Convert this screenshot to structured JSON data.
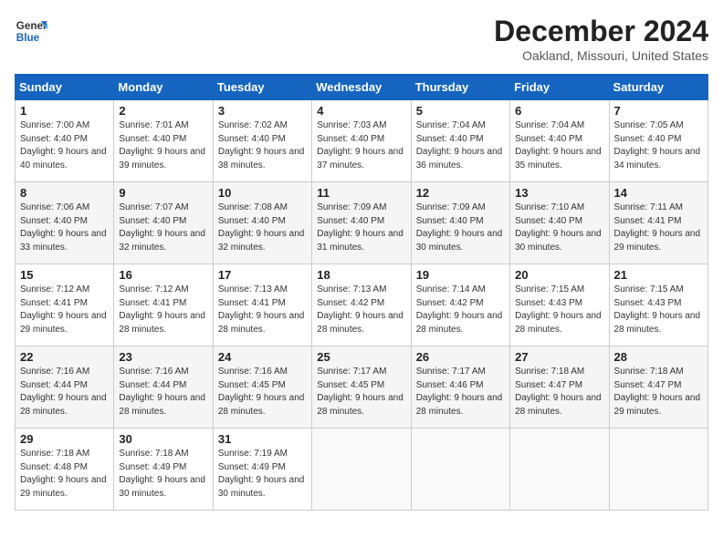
{
  "logo": {
    "line1": "General",
    "line2": "Blue"
  },
  "title": "December 2024",
  "subtitle": "Oakland, Missouri, United States",
  "days_of_week": [
    "Sunday",
    "Monday",
    "Tuesday",
    "Wednesday",
    "Thursday",
    "Friday",
    "Saturday"
  ],
  "weeks": [
    [
      {
        "day": "1",
        "sunrise": "7:00 AM",
        "sunset": "4:40 PM",
        "daylight": "9 hours and 40 minutes."
      },
      {
        "day": "2",
        "sunrise": "7:01 AM",
        "sunset": "4:40 PM",
        "daylight": "9 hours and 39 minutes."
      },
      {
        "day": "3",
        "sunrise": "7:02 AM",
        "sunset": "4:40 PM",
        "daylight": "9 hours and 38 minutes."
      },
      {
        "day": "4",
        "sunrise": "7:03 AM",
        "sunset": "4:40 PM",
        "daylight": "9 hours and 37 minutes."
      },
      {
        "day": "5",
        "sunrise": "7:04 AM",
        "sunset": "4:40 PM",
        "daylight": "9 hours and 36 minutes."
      },
      {
        "day": "6",
        "sunrise": "7:04 AM",
        "sunset": "4:40 PM",
        "daylight": "9 hours and 35 minutes."
      },
      {
        "day": "7",
        "sunrise": "7:05 AM",
        "sunset": "4:40 PM",
        "daylight": "9 hours and 34 minutes."
      }
    ],
    [
      {
        "day": "8",
        "sunrise": "7:06 AM",
        "sunset": "4:40 PM",
        "daylight": "9 hours and 33 minutes."
      },
      {
        "day": "9",
        "sunrise": "7:07 AM",
        "sunset": "4:40 PM",
        "daylight": "9 hours and 32 minutes."
      },
      {
        "day": "10",
        "sunrise": "7:08 AM",
        "sunset": "4:40 PM",
        "daylight": "9 hours and 32 minutes."
      },
      {
        "day": "11",
        "sunrise": "7:09 AM",
        "sunset": "4:40 PM",
        "daylight": "9 hours and 31 minutes."
      },
      {
        "day": "12",
        "sunrise": "7:09 AM",
        "sunset": "4:40 PM",
        "daylight": "9 hours and 30 minutes."
      },
      {
        "day": "13",
        "sunrise": "7:10 AM",
        "sunset": "4:40 PM",
        "daylight": "9 hours and 30 minutes."
      },
      {
        "day": "14",
        "sunrise": "7:11 AM",
        "sunset": "4:41 PM",
        "daylight": "9 hours and 29 minutes."
      }
    ],
    [
      {
        "day": "15",
        "sunrise": "7:12 AM",
        "sunset": "4:41 PM",
        "daylight": "9 hours and 29 minutes."
      },
      {
        "day": "16",
        "sunrise": "7:12 AM",
        "sunset": "4:41 PM",
        "daylight": "9 hours and 28 minutes."
      },
      {
        "day": "17",
        "sunrise": "7:13 AM",
        "sunset": "4:41 PM",
        "daylight": "9 hours and 28 minutes."
      },
      {
        "day": "18",
        "sunrise": "7:13 AM",
        "sunset": "4:42 PM",
        "daylight": "9 hours and 28 minutes."
      },
      {
        "day": "19",
        "sunrise": "7:14 AM",
        "sunset": "4:42 PM",
        "daylight": "9 hours and 28 minutes."
      },
      {
        "day": "20",
        "sunrise": "7:15 AM",
        "sunset": "4:43 PM",
        "daylight": "9 hours and 28 minutes."
      },
      {
        "day": "21",
        "sunrise": "7:15 AM",
        "sunset": "4:43 PM",
        "daylight": "9 hours and 28 minutes."
      }
    ],
    [
      {
        "day": "22",
        "sunrise": "7:16 AM",
        "sunset": "4:44 PM",
        "daylight": "9 hours and 28 minutes."
      },
      {
        "day": "23",
        "sunrise": "7:16 AM",
        "sunset": "4:44 PM",
        "daylight": "9 hours and 28 minutes."
      },
      {
        "day": "24",
        "sunrise": "7:16 AM",
        "sunset": "4:45 PM",
        "daylight": "9 hours and 28 minutes."
      },
      {
        "day": "25",
        "sunrise": "7:17 AM",
        "sunset": "4:45 PM",
        "daylight": "9 hours and 28 minutes."
      },
      {
        "day": "26",
        "sunrise": "7:17 AM",
        "sunset": "4:46 PM",
        "daylight": "9 hours and 28 minutes."
      },
      {
        "day": "27",
        "sunrise": "7:18 AM",
        "sunset": "4:47 PM",
        "daylight": "9 hours and 28 minutes."
      },
      {
        "day": "28",
        "sunrise": "7:18 AM",
        "sunset": "4:47 PM",
        "daylight": "9 hours and 29 minutes."
      }
    ],
    [
      {
        "day": "29",
        "sunrise": "7:18 AM",
        "sunset": "4:48 PM",
        "daylight": "9 hours and 29 minutes."
      },
      {
        "day": "30",
        "sunrise": "7:18 AM",
        "sunset": "4:49 PM",
        "daylight": "9 hours and 30 minutes."
      },
      {
        "day": "31",
        "sunrise": "7:19 AM",
        "sunset": "4:49 PM",
        "daylight": "9 hours and 30 minutes."
      },
      null,
      null,
      null,
      null
    ]
  ]
}
